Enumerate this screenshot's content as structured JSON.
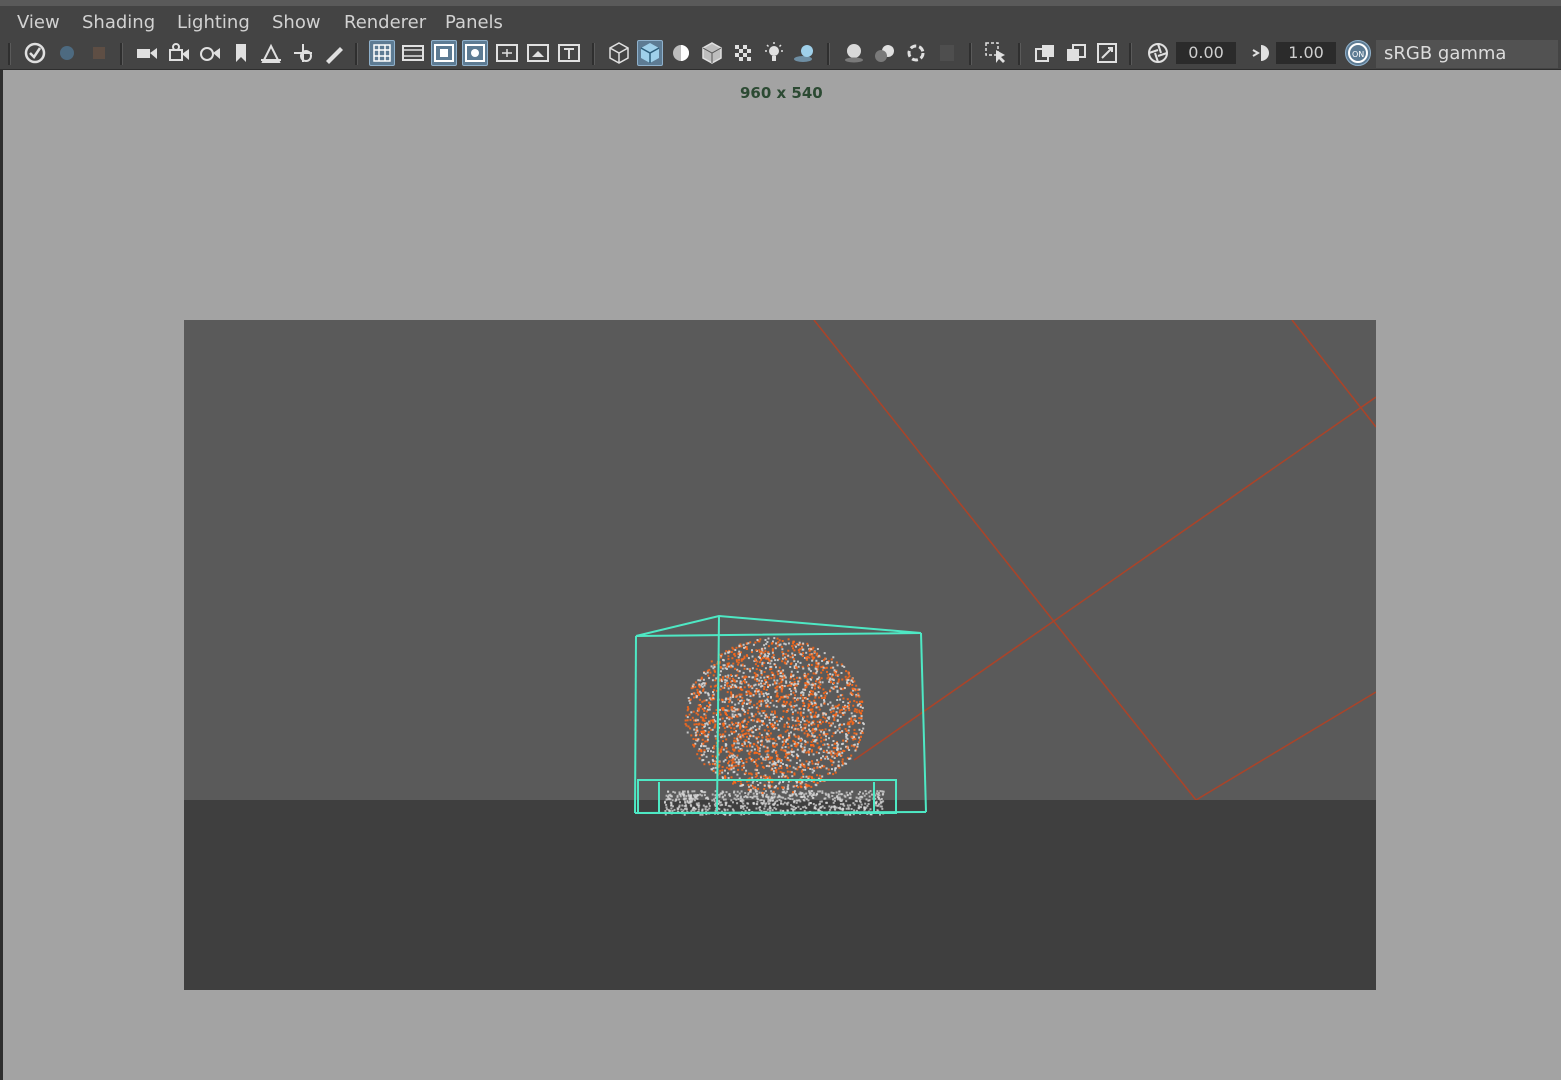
{
  "menu": [
    "View",
    "Shading",
    "Lighting",
    "Show",
    "Renderer",
    "Panels"
  ],
  "toolbar": {
    "exposure_value": "0.00",
    "gamma_value": "1.00",
    "color_space": "sRGB gamma",
    "colors": {
      "active_bg": "#5d7b93",
      "toolbar_bg": "#444444"
    }
  },
  "viewport": {
    "resolution_label": "960 x 540",
    "colors": {
      "background": "#a3a3a3",
      "sky": "#5a5a5a",
      "ground": "#3f3f3f",
      "grid_line": "#a9442a",
      "bounding_box": "#4ee8c4",
      "particles_orange": "#ff6a1a",
      "particles_white": "#d9d9d9"
    }
  }
}
